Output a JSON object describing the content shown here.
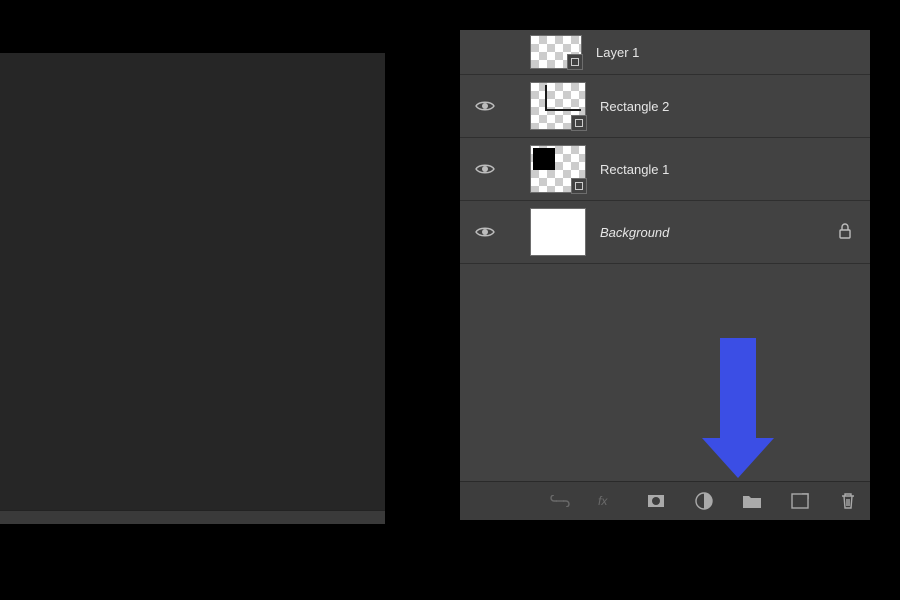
{
  "layers": [
    {
      "name": "Layer 1",
      "visible": true,
      "locked": false,
      "kind": "pixel-partial"
    },
    {
      "name": "Rectangle 2",
      "visible": true,
      "locked": false,
      "kind": "shape"
    },
    {
      "name": "Rectangle 1",
      "visible": true,
      "locked": false,
      "kind": "shape-black"
    },
    {
      "name": "Background",
      "visible": true,
      "locked": true,
      "kind": "white",
      "italic": true
    }
  ],
  "footer_buttons": [
    {
      "id": "link",
      "label": "Link layers"
    },
    {
      "id": "fx",
      "label": "Add layer style"
    },
    {
      "id": "mask",
      "label": "Add layer mask"
    },
    {
      "id": "adjust",
      "label": "New fill or adjustment layer"
    },
    {
      "id": "group",
      "label": "New group"
    },
    {
      "id": "new",
      "label": "New layer"
    },
    {
      "id": "trash",
      "label": "Delete layer"
    }
  ],
  "annotation": {
    "target": "group",
    "color": "#3b4ee5"
  }
}
